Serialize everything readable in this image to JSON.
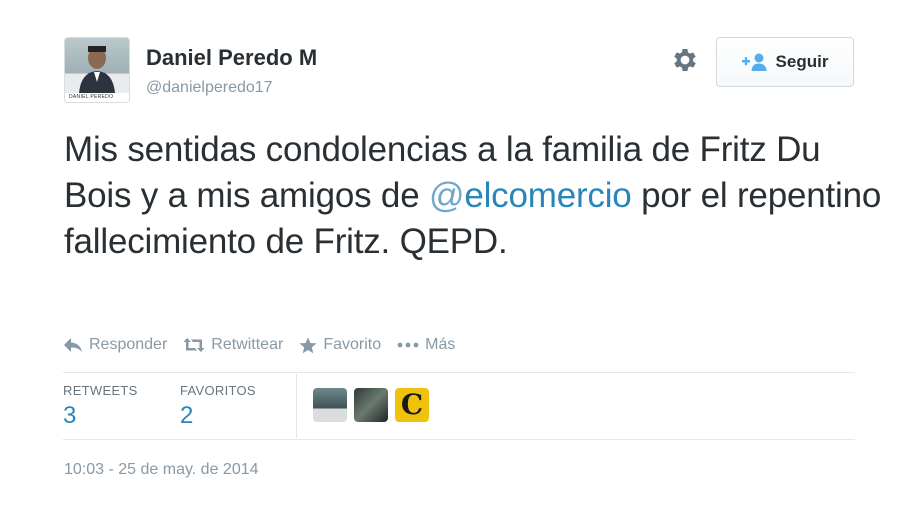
{
  "user": {
    "name": "Daniel Peredo M",
    "handle": "@danielperedo17",
    "avatar_caption": "DANIEL PEREDO"
  },
  "follow_button": {
    "label": "Seguir",
    "icon": "add-user-icon"
  },
  "settings": {
    "icon": "gear-icon"
  },
  "tweet": {
    "text_part1": "Mis sentidas condolencias a la familia de Fritz Du Bois y a mis amigos de ",
    "mention_at": "@",
    "mention_name": "elcomercio",
    "text_part2": " por el repentino fallecimiento de Fritz. QEPD."
  },
  "actions": {
    "reply": "Responder",
    "retweet": "Retwittear",
    "favorite": "Favorito",
    "more": "Más"
  },
  "stats": {
    "retweets_label": "RETWEETS",
    "retweets_count": "3",
    "favorites_label": "FAVORITOS",
    "favorites_count": "2"
  },
  "favoriters": {
    "fa3_letter": "C"
  },
  "timestamp": "10:03 - 25 de may. de 2014",
  "colors": {
    "link": "#2a86b8",
    "text": "#292f33",
    "muted": "#8899a6",
    "divider": "#e1e8ed"
  }
}
